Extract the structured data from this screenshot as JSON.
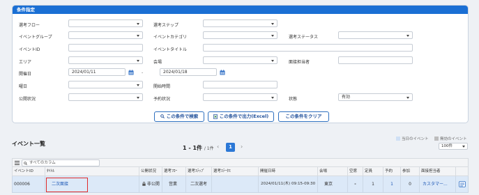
{
  "panel": {
    "title": "条件指定"
  },
  "form": {
    "flow": "選考フロー",
    "step": "選考ステップ",
    "group": "イベントグループ",
    "category": "イベントカテゴリ",
    "sel_status": "選考ステータス",
    "event_id": "イベントID",
    "event_title": "イベントタイトル",
    "area": "エリア",
    "venue": "会場",
    "interviewer": "面接担当者",
    "date": "開催日",
    "date_from": "2024/01/11",
    "date_to": "2024/01/18",
    "date_sep": "-",
    "weekday": "曜日",
    "start_time": "開始時間",
    "pub_status": "公開状況",
    "res_status": "予約状況",
    "state": "状態",
    "state_value": "有効"
  },
  "buttons": {
    "search": "この条件で検索",
    "excel": "この条件で出力(Excel)",
    "clear": "この条件をクリア"
  },
  "list": {
    "title": "イベント一覧",
    "count": "1 - 1件",
    "count_sub": "/ 1件",
    "prev": "‹",
    "page": "1",
    "next": "›",
    "legend_today": "当日のイベント",
    "legend_invalid": "無効のイベント",
    "per_page": "100件",
    "search_placeholder": "すべてのカラム"
  },
  "table": {
    "headers": [
      "イベントID",
      "ﾀｲﾄﾙ",
      "公開状況",
      "選考ﾌﾛｰ",
      "選考ｽﾃｯﾌﾟ",
      "選考ｽﾃｰﾀｽ",
      "開催日時",
      "会場",
      "空席",
      "定員",
      "予約",
      "参加",
      "面接担当者"
    ],
    "row": {
      "id": "000006",
      "title": "二次面接",
      "pub": "非公開",
      "flow": "営業",
      "step": "二次選考",
      "status": "",
      "datetime": "2024/01/11(木) 09:15-09:30",
      "venue": "東京",
      "vacancy": "-",
      "capacity": "1",
      "reserved": "1",
      "joined": "0",
      "interviewer": "カスタマー..."
    }
  },
  "colors": {
    "accent": "#1a6fd4",
    "row_selected": "#dce9f8",
    "highlight": "#e02a2a"
  }
}
